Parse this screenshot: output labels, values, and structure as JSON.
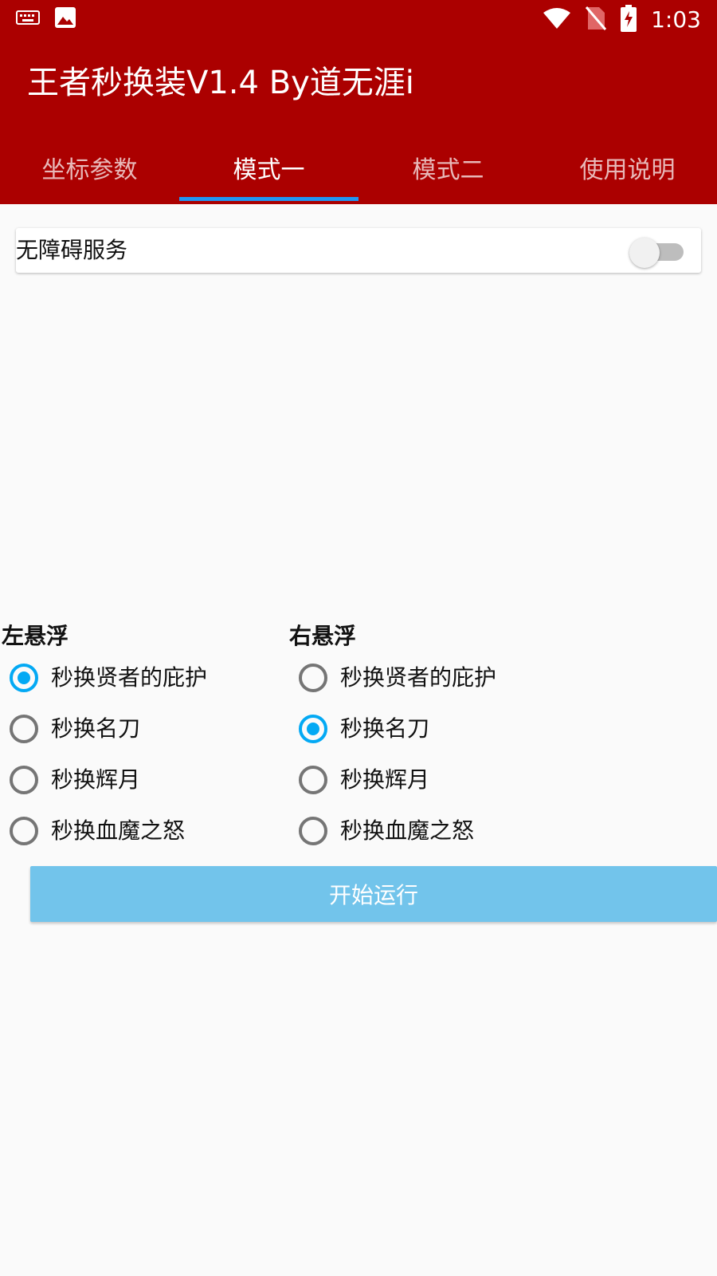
{
  "status_bar": {
    "time": "1:03",
    "icons_left": [
      "keyboard-icon",
      "image-icon"
    ],
    "icons_right": [
      "wifi-icon",
      "no-sim-icon",
      "battery-charging-icon"
    ]
  },
  "app": {
    "title": "王者秒换装V1.4 By道无涯i",
    "accent_color": "#ab0000"
  },
  "tabs": [
    {
      "label": "坐标参数",
      "active": false
    },
    {
      "label": "模式一",
      "active": true
    },
    {
      "label": "模式二",
      "active": false
    },
    {
      "label": "使用说明",
      "active": false
    }
  ],
  "accessibility": {
    "label": "无障碍服务",
    "enabled": false
  },
  "left_group": {
    "title": "左悬浮",
    "options": [
      {
        "label": "秒换贤者的庇护",
        "checked": true
      },
      {
        "label": "秒换名刀",
        "checked": false
      },
      {
        "label": "秒换辉月",
        "checked": false
      },
      {
        "label": "秒换血魔之怒",
        "checked": false
      }
    ]
  },
  "right_group": {
    "title": "右悬浮",
    "options": [
      {
        "label": "秒换贤者的庇护",
        "checked": false
      },
      {
        "label": "秒换名刀",
        "checked": true
      },
      {
        "label": "秒换辉月",
        "checked": false
      },
      {
        "label": "秒换血魔之怒",
        "checked": false
      }
    ]
  },
  "start_button": {
    "label": "开始运行",
    "color": "#72c4eb"
  }
}
